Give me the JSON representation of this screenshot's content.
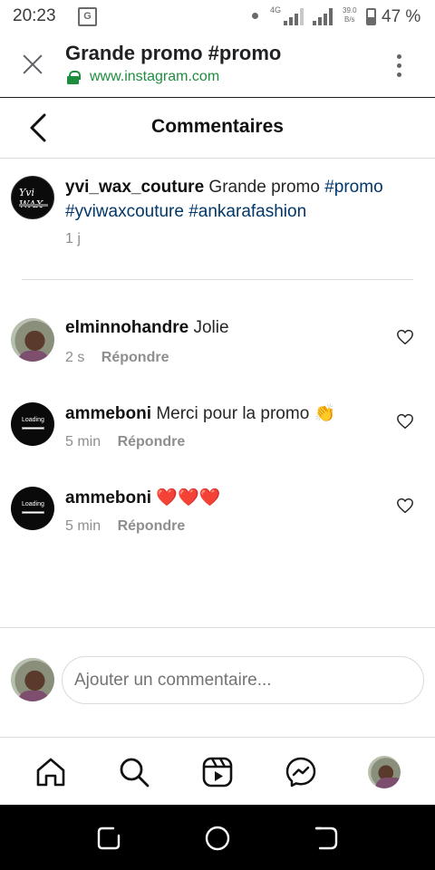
{
  "status_bar": {
    "time": "20:23",
    "network_type": "4G",
    "speed_value": "39.0",
    "speed_unit": "B/s",
    "battery_percent": "47 %",
    "battery_level": 0.47
  },
  "browser": {
    "page_title": "Grande promo #promo",
    "url": "www.instagram.com"
  },
  "header": {
    "title": "Commentaires"
  },
  "caption": {
    "username": "yvi_wax_couture",
    "text": "Grande promo ",
    "hashtags": [
      "#promo",
      "#yviwaxcouture",
      "#ankarafashion"
    ],
    "time": "1 j"
  },
  "comments": [
    {
      "username": "elminnohandre",
      "text": "Jolie",
      "time": "2 s",
      "reply_label": "Répondre",
      "avatar": "photo"
    },
    {
      "username": "ammeboni",
      "text": "Merci pour la promo 👏",
      "time": "5 min",
      "reply_label": "Répondre",
      "avatar": "loading"
    },
    {
      "username": "ammeboni",
      "text": "❤️❤️❤️",
      "time": "5 min",
      "reply_label": "Répondre",
      "avatar": "loading"
    }
  ],
  "composer": {
    "placeholder": "Ajouter un commentaire..."
  },
  "nav": {
    "items": [
      "home-icon",
      "search-icon",
      "reels-icon",
      "messenger-icon",
      "profile-avatar"
    ]
  },
  "colors": {
    "hashtag": "#00376b",
    "secure_green": "#1e8e3e",
    "muted": "#8e8e8e",
    "divider": "#dbdbdb"
  }
}
